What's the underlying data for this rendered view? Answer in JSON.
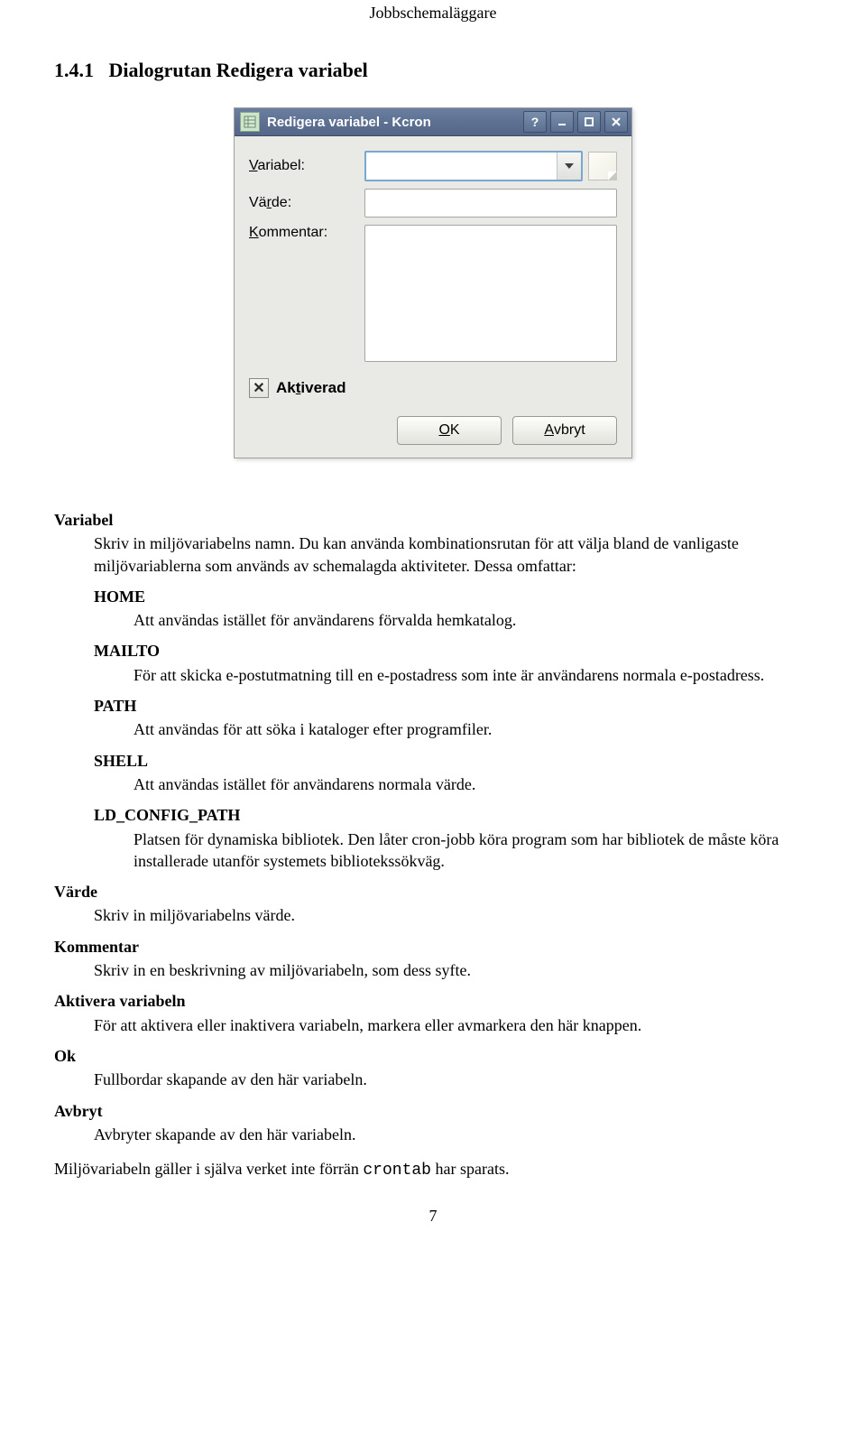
{
  "running_head": "Jobbschemaläggare",
  "section_number": "1.4.1",
  "section_title": "Dialogrutan Redigera variabel",
  "dialog": {
    "title": "Redigera variabel - Kcron",
    "label_variable_pre": "V",
    "label_variable_post": "ariabel:",
    "label_value_pre": "Vä",
    "label_value_ul": "r",
    "label_value_post": "de:",
    "label_comment_ul": "K",
    "label_comment_post": "ommentar:",
    "checkbox_mark": "✕",
    "checkbox_pre": "Ak",
    "checkbox_ul": "t",
    "checkbox_post": "iverad",
    "ok_ul": "O",
    "ok_post": "K",
    "cancel_ul": "A",
    "cancel_post": "vbryt"
  },
  "defs": {
    "variabel_dt": "Variabel",
    "variabel_dd": "Skriv in miljövariabelns namn. Du kan använda kombinationsrutan för att välja bland de vanligaste miljövariablerna som används av schemalagda aktiviteter. Dessa omfattar:",
    "nested": {
      "home_dt": "HOME",
      "home_dd": "Att användas istället för användarens förvalda hemkatalog.",
      "mailto_dt": "MAILTO",
      "mailto_dd": "För att skicka e-postutmatning till en e-postadress som inte är användarens normala e-postadress.",
      "path_dt": "PATH",
      "path_dd": "Att användas för att söka i kataloger efter programfiler.",
      "shell_dt": "SHELL",
      "shell_dd": "Att användas istället för användarens normala värde.",
      "ld_dt": "LD_CONFIG_PATH",
      "ld_dd": "Platsen för dynamiska bibliotek. Den låter cron-jobb köra program som har bibliotek de måste köra installerade utanför systemets bibliotekssökväg."
    },
    "varde_dt": "Värde",
    "varde_dd": "Skriv in miljövariabelns värde.",
    "kommentar_dt": "Kommentar",
    "kommentar_dd": "Skriv in en beskrivning av miljövariabeln, som dess syfte.",
    "aktivera_dt": "Aktivera variabeln",
    "aktivera_dd": "För att aktivera eller inaktivera variabeln, markera eller avmarkera den här knappen.",
    "ok_dt": "Ok",
    "ok_dd": "Fullbordar skapande av den här variabeln.",
    "avbryt_dt": "Avbryt",
    "avbryt_dd": "Avbryter skapande av den här variabeln."
  },
  "trailer_pre": "Miljövariabeln gäller i själva verket inte förrän ",
  "trailer_code": "crontab",
  "trailer_post": " har sparats.",
  "page_number": "7"
}
